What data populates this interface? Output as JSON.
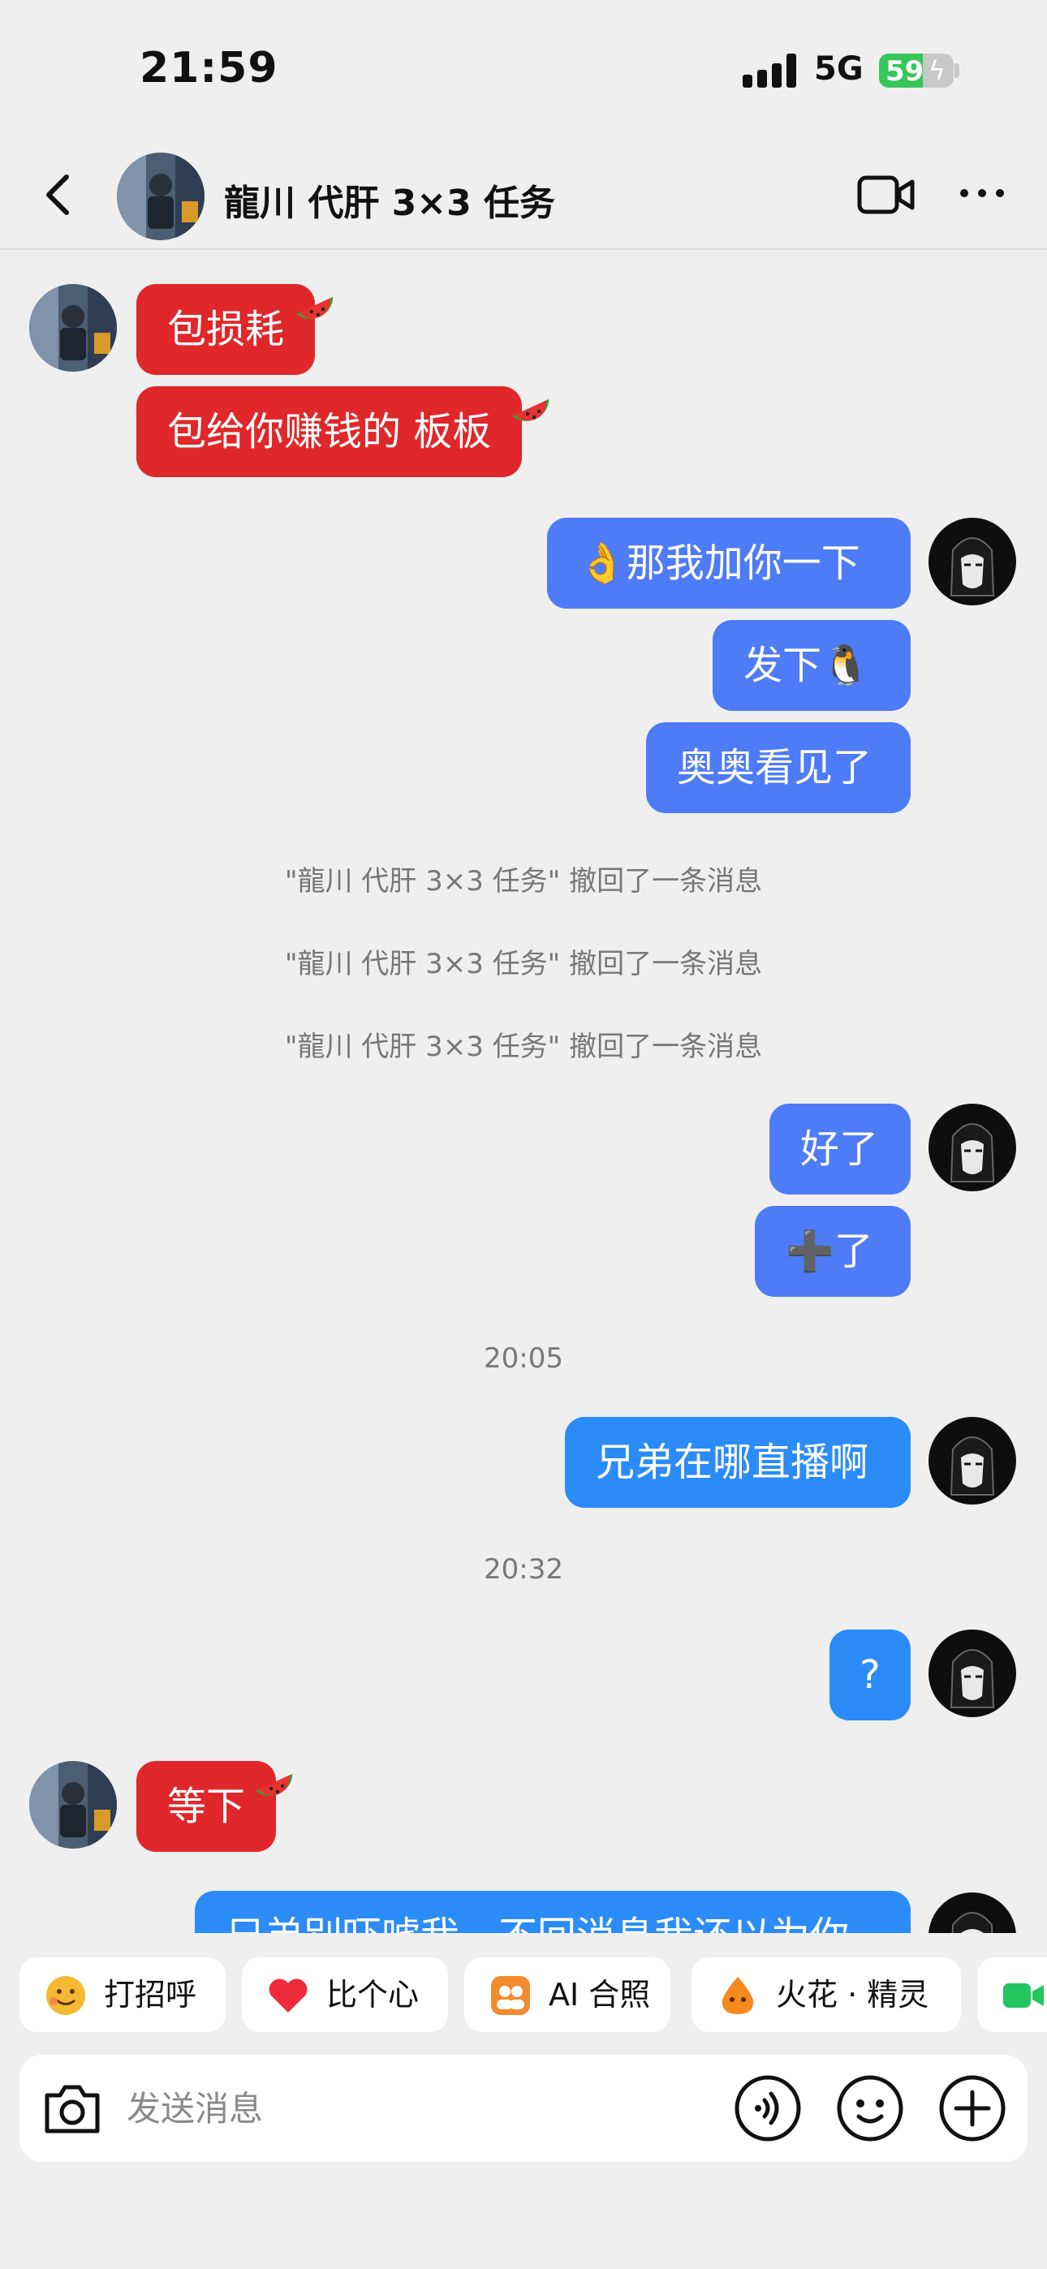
{
  "status_bar": {
    "time": "21:59",
    "network": "5G",
    "battery": "59",
    "battery_fraction": 0.59
  },
  "header": {
    "title": "龍川 代肝 3×3 任务"
  },
  "messages": [
    {
      "side": "left",
      "text": "包损耗",
      "color": "#e0272a"
    },
    {
      "side": "left",
      "text": "包给你赚钱的 板板",
      "color": "#e0272a"
    },
    {
      "side": "right",
      "text": "👌那我加你一下",
      "color": "#4e7bf6"
    },
    {
      "side": "right",
      "text": "发下🐧",
      "color": "#4e7bf6"
    },
    {
      "side": "right",
      "text": "奥奥看见了",
      "color": "#4e7bf6"
    },
    {
      "side": "right",
      "text": "好了",
      "color": "#4e7bf6"
    },
    {
      "side": "right",
      "text": "➕了",
      "color": "#4e7bf6"
    },
    {
      "side": "right",
      "text": "兄弟在哪直播啊",
      "color": "#2b8bf7"
    },
    {
      "side": "right",
      "text": "?",
      "color": "#2b8bf7"
    },
    {
      "side": "left",
      "text": "等下",
      "color": "#e0272a"
    },
    {
      "side": "right",
      "text": "兄弟别吓唬我，不回消息我还以为你",
      "color": "#2b8bf7"
    }
  ],
  "system_notices": [
    "\"龍川 代肝 3×3 任务\" 撤回了一条消息",
    "\"龍川 代肝 3×3 任务\" 撤回了一条消息",
    "\"龍川 代肝 3×3 任务\" 撤回了一条消息"
  ],
  "timestamps": [
    "20:05",
    "20:32"
  ],
  "quick_replies": [
    {
      "label": "打招呼",
      "icon": "greeting-emoji-icon"
    },
    {
      "label": "比个心",
      "icon": "heart-icon"
    },
    {
      "label": "AI 合照",
      "icon": "ai-photo-icon"
    },
    {
      "label": "火花 · 精灵",
      "icon": "spark-sprite-icon"
    },
    {
      "label": "",
      "icon": "video-call-icon"
    }
  ],
  "input": {
    "placeholder": "发送消息"
  },
  "icons": {
    "back": "back-arrow-icon",
    "video": "video-call-icon",
    "more": "more-icon",
    "camera": "camera-icon",
    "voice": "voice-icon",
    "emoji": "emoji-icon",
    "plus": "plus-icon",
    "sticker": "watermelon-icon"
  },
  "colors": {
    "background": "#efeff0",
    "peer_bubble": "#e0272a",
    "self_bubble": "#4e7bf6",
    "self_bubble_alt": "#2b8bf7",
    "battery": "#35c759"
  }
}
